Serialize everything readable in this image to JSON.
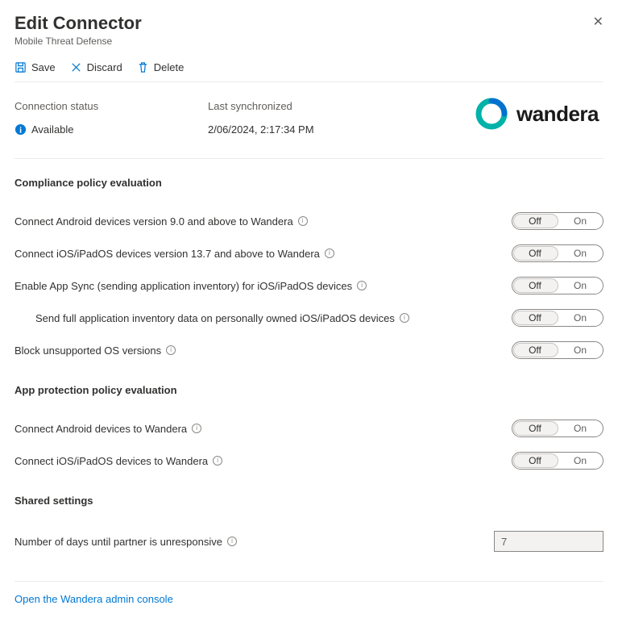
{
  "header": {
    "title": "Edit Connector",
    "subtitle": "Mobile Threat Defense"
  },
  "toolbar": {
    "save": "Save",
    "discard": "Discard",
    "delete": "Delete"
  },
  "status": {
    "conn_label": "Connection status",
    "conn_value": "Available",
    "sync_label": "Last synchronized",
    "sync_value": "2/06/2024, 2:17:34 PM"
  },
  "brand": {
    "name": "wandera"
  },
  "sections": {
    "compliance": {
      "title": "Compliance policy evaluation",
      "rows": [
        {
          "label": "Connect Android devices version 9.0 and above to Wandera",
          "state": "Off"
        },
        {
          "label": "Connect iOS/iPadOS devices version 13.7 and above to Wandera",
          "state": "Off"
        },
        {
          "label": "Enable App Sync (sending application inventory) for iOS/iPadOS devices",
          "state": "Off"
        },
        {
          "label": "Send full application inventory data on personally owned iOS/iPadOS devices",
          "state": "Off",
          "indent": true
        },
        {
          "label": "Block unsupported OS versions",
          "state": "Off"
        }
      ]
    },
    "app_protection": {
      "title": "App protection policy evaluation",
      "rows": [
        {
          "label": "Connect Android devices to Wandera",
          "state": "Off"
        },
        {
          "label": "Connect iOS/iPadOS devices to Wandera",
          "state": "Off"
        }
      ]
    },
    "shared": {
      "title": "Shared settings",
      "days_label": "Number of days until partner is unresponsive",
      "days_value": "7"
    }
  },
  "toggle_labels": {
    "off": "Off",
    "on": "On"
  },
  "footer_link": "Open the Wandera admin console"
}
